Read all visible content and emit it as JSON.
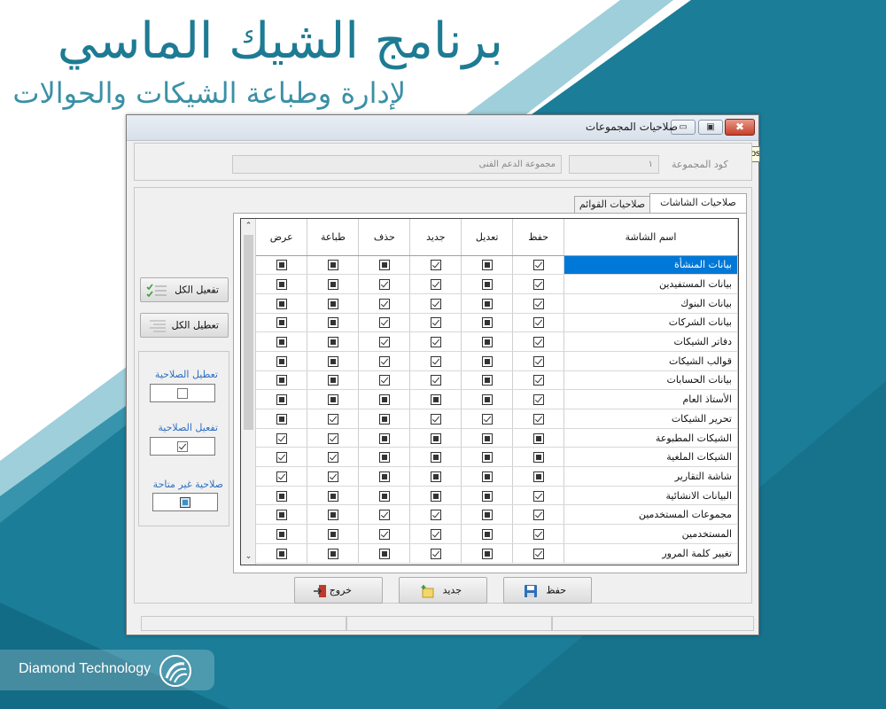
{
  "banner": {
    "title": "برنامج الشيك الماسي",
    "subtitle": "لإدارة وطباعة الشيكات والحوالات",
    "brand": "Diamond Technology",
    "accent": "#1d7b93"
  },
  "window": {
    "title": "صلاحيات المجموعات",
    "close_symbol": "✖",
    "tooltip": "Close"
  },
  "header": {
    "group_code_label": "كود المجموعة",
    "group_code_value": "١",
    "group_name_value": "مجموعة الدعم الفنى"
  },
  "tabs": [
    {
      "label": "صلاحيات الشاشات",
      "active": true
    },
    {
      "label": "صلاحيات القوائم",
      "active": false
    }
  ],
  "grid": {
    "columns": [
      "اسم الشاشة",
      "حفظ",
      "تعديل",
      "جديد",
      "حذف",
      "طباعة",
      "عرض"
    ],
    "rows": [
      {
        "name": "بيانات المنشأة",
        "selected": true,
        "perms": [
          "on",
          "ind",
          "on",
          "ind",
          "ind",
          "ind"
        ]
      },
      {
        "name": "بيانات المستفيدين",
        "perms": [
          "on",
          "ind",
          "on",
          "on",
          "ind",
          "ind"
        ]
      },
      {
        "name": "بيانات البنوك",
        "perms": [
          "on",
          "ind",
          "on",
          "on",
          "ind",
          "ind"
        ]
      },
      {
        "name": "بيانات الشركات",
        "perms": [
          "on",
          "ind",
          "on",
          "on",
          "ind",
          "ind"
        ]
      },
      {
        "name": "دفاتر الشيكات",
        "perms": [
          "on",
          "ind",
          "on",
          "on",
          "ind",
          "ind"
        ]
      },
      {
        "name": "قوالب الشيكات",
        "perms": [
          "on",
          "ind",
          "on",
          "on",
          "ind",
          "ind"
        ]
      },
      {
        "name": "بيانات الحسابات",
        "perms": [
          "on",
          "ind",
          "on",
          "on",
          "ind",
          "ind"
        ]
      },
      {
        "name": "الأستاذ العام",
        "perms": [
          "on",
          "ind",
          "ind",
          "ind",
          "ind",
          "ind"
        ]
      },
      {
        "name": "تحرير الشيكات",
        "perms": [
          "on",
          "on",
          "on",
          "ind",
          "on",
          "ind"
        ]
      },
      {
        "name": "الشيكات المطبوعة",
        "perms": [
          "ind",
          "ind",
          "ind",
          "ind",
          "on",
          "on"
        ]
      },
      {
        "name": "الشيكات الملغية",
        "perms": [
          "ind",
          "ind",
          "ind",
          "ind",
          "on",
          "on"
        ]
      },
      {
        "name": "شاشة التقارير",
        "perms": [
          "ind",
          "ind",
          "ind",
          "ind",
          "on",
          "on"
        ]
      },
      {
        "name": "البيانات الانشائية",
        "perms": [
          "on",
          "ind",
          "ind",
          "ind",
          "ind",
          "ind"
        ]
      },
      {
        "name": "مجموعات المستخدمين",
        "perms": [
          "on",
          "ind",
          "on",
          "on",
          "ind",
          "ind"
        ]
      },
      {
        "name": "المستخدمين",
        "perms": [
          "on",
          "ind",
          "on",
          "on",
          "ind",
          "ind"
        ]
      },
      {
        "name": "تغيير كلمة المرور",
        "perms": [
          "on",
          "ind",
          "on",
          "ind",
          "ind",
          "ind"
        ]
      }
    ]
  },
  "side": {
    "enable_all": "تفعيل الكل",
    "disable_all": "تعطيل الكل",
    "legend": [
      {
        "label": "تعطيل الصلاحية",
        "state": "off"
      },
      {
        "label": "تفعيل الصلاحية",
        "state": "on"
      },
      {
        "label": "صلاحية غير متاحة",
        "state": "na"
      }
    ]
  },
  "footer": {
    "save": "حفظ",
    "new": "جديد",
    "exit": "خروج"
  },
  "icons": [
    "minimize-icon",
    "maximize-icon",
    "close-icon",
    "save-icon",
    "new-icon",
    "exit-icon",
    "check-list-icon",
    "uncheck-list-icon",
    "diamond-logo-icon"
  ]
}
